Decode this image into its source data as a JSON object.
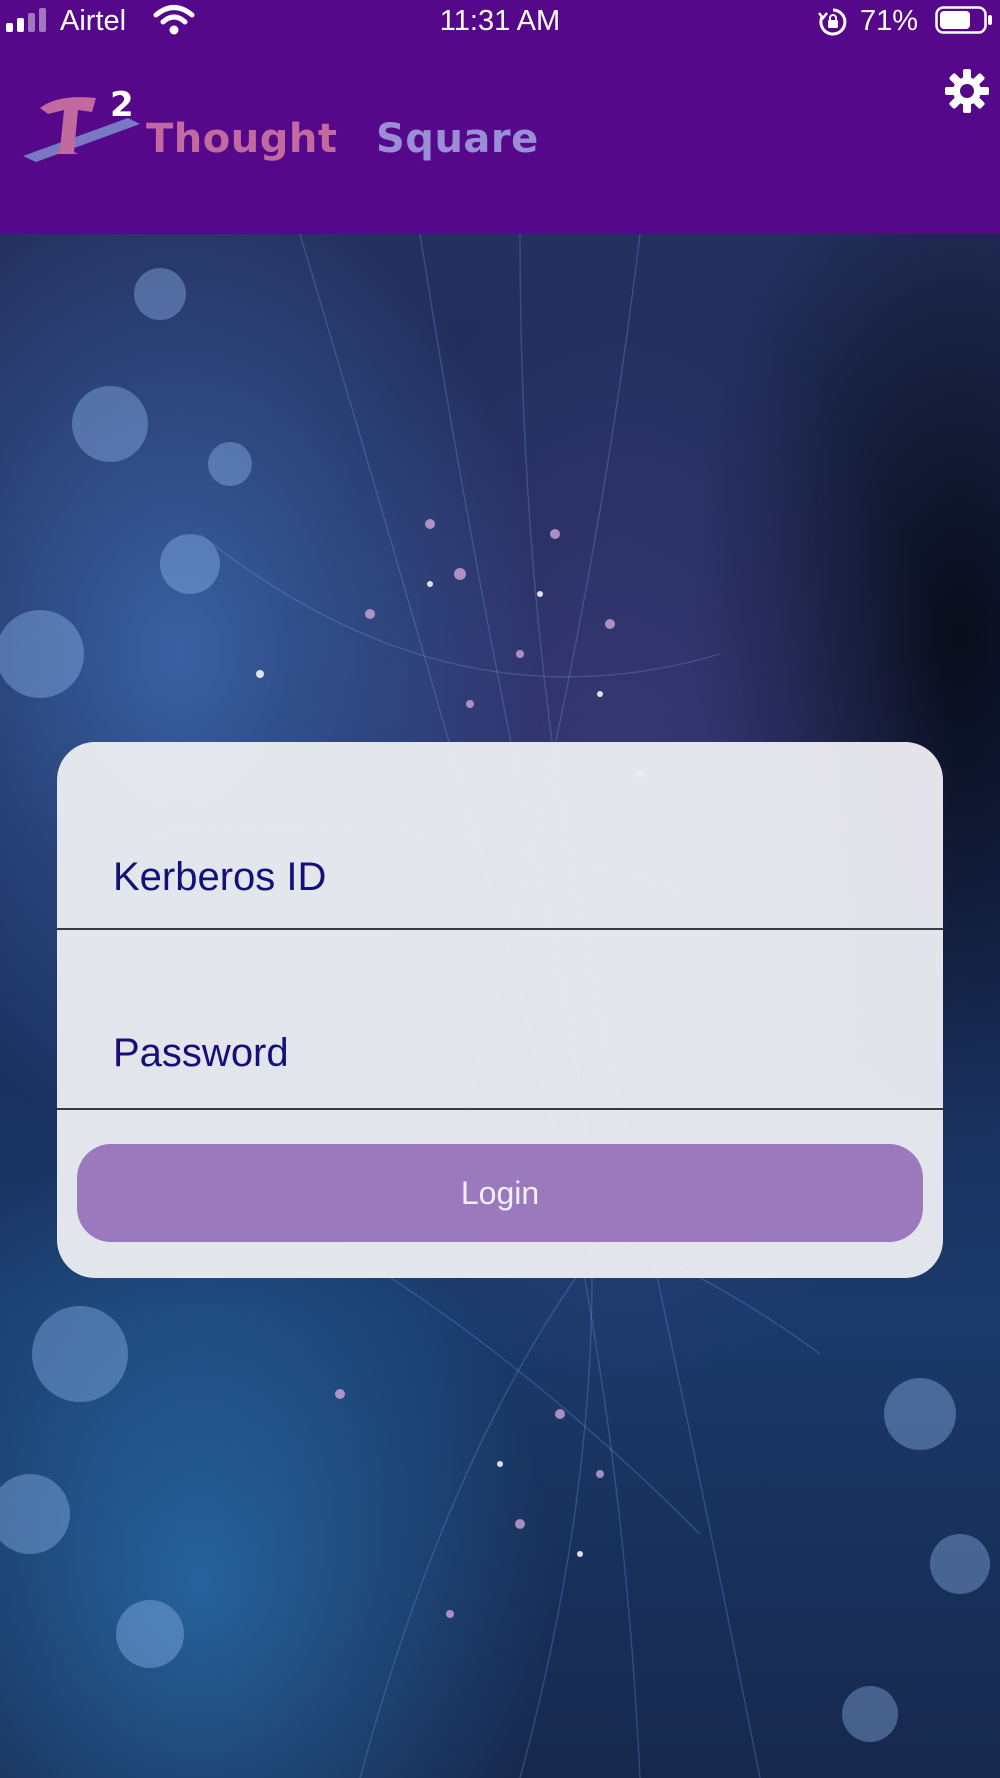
{
  "status_bar": {
    "carrier": "Airtel",
    "time": "11:31 AM",
    "battery_percent": "71%",
    "signal_bars_active": 2,
    "signal_bars_total": 4,
    "battery_level": 0.71,
    "icons": [
      "signal-icon",
      "wifi-icon",
      "rotation-lock-icon",
      "battery-icon"
    ]
  },
  "header": {
    "logo_mark": "T2",
    "logo_word_1": "Thought",
    "logo_word_2": "Square",
    "settings_icon": "gear-icon",
    "background_color": "#55088a"
  },
  "login": {
    "kerberos_placeholder": "Kerberos ID",
    "kerberos_value": "",
    "password_placeholder": "Password",
    "password_value": "",
    "login_label": "Login",
    "button_color": "#9b79bd",
    "text_color": "#14107a"
  }
}
